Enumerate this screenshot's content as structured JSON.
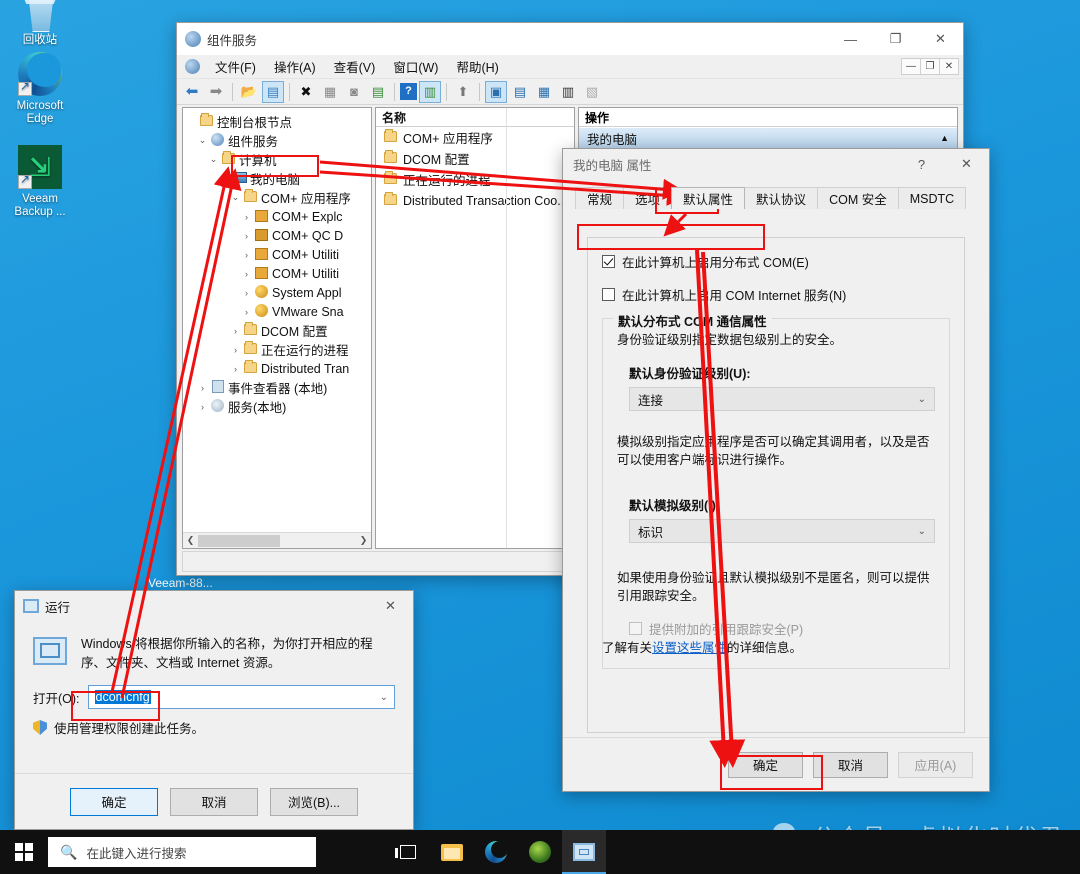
{
  "desktop": {
    "icons": [
      {
        "name": "recycle-bin",
        "label": "回收站"
      },
      {
        "name": "microsoft-edge",
        "label": "Microsoft\nEdge",
        "line1": "Microsoft",
        "line2": "Edge"
      },
      {
        "name": "veeam-backup",
        "label": "Veeam Backup ...",
        "line1": "Veeam",
        "line2": "Backup ..."
      }
    ],
    "veeam_logo_glyph": "⇲",
    "task_label": "Veeam-88..."
  },
  "mmc": {
    "title": "组件服务",
    "menu": [
      {
        "label": "文件(F)"
      },
      {
        "label": "操作(A)"
      },
      {
        "label": "查看(V)"
      },
      {
        "label": "窗口(W)"
      },
      {
        "label": "帮助(H)"
      }
    ],
    "mdi_buttons": [
      "—",
      "❐",
      "✕"
    ],
    "window_buttons": {
      "minimize": "—",
      "maximize": "❐",
      "close": "✕"
    },
    "toolbar": [
      {
        "name": "back-icon",
        "glyph": "⬅",
        "color": "#2e7bc4"
      },
      {
        "name": "forward-icon",
        "glyph": "➡",
        "color": "#777777"
      },
      {
        "name": "up-folder-icon",
        "glyph": "📂",
        "color": "#d9a43a"
      },
      {
        "name": "show-console-tree-icon",
        "glyph": "▤",
        "selected": true
      },
      {
        "name": "delete-icon",
        "glyph": "✖",
        "color": "#111111"
      },
      {
        "name": "properties-icon",
        "glyph": "▦",
        "color": "#8a8a8a"
      },
      {
        "name": "refresh-icon",
        "glyph": "◙",
        "color": "#8a8a8a"
      },
      {
        "name": "export-list-icon",
        "glyph": "▤",
        "color": "#3c8c3c"
      },
      {
        "name": "help-icon",
        "glyph": "?",
        "color": "#ffffff"
      },
      {
        "name": "show-action-pane-icon",
        "glyph": "▥",
        "selected": true
      },
      {
        "name": "new-window-icon",
        "glyph": "⬆",
        "color": "#777777"
      },
      {
        "name": "large-icons-icon",
        "glyph": "▣",
        "selected": true
      },
      {
        "name": "small-icons-icon",
        "glyph": "▤"
      },
      {
        "name": "list-view-icon",
        "glyph": "▦"
      },
      {
        "name": "detail-view-icon",
        "glyph": "▥"
      },
      {
        "name": "filter-icon",
        "glyph": "▧",
        "color": "#9a9a9a"
      }
    ],
    "tree": [
      {
        "depth": 0,
        "twisty": "",
        "icon": "folder",
        "label": "控制台根节点"
      },
      {
        "depth": 1,
        "twisty": "⌄",
        "icon": "services",
        "label": "组件服务"
      },
      {
        "depth": 2,
        "twisty": "⌄",
        "icon": "folder",
        "label": "计算机"
      },
      {
        "depth": 3,
        "twisty": "⌄",
        "icon": "computer",
        "label": "我的电脑",
        "highlighted": true
      },
      {
        "depth": 4,
        "twisty": "⌄",
        "icon": "folder",
        "label": "COM+ 应用程序"
      },
      {
        "depth": 5,
        "twisty": "›",
        "icon": "comapp",
        "label": "COM+ Explc"
      },
      {
        "depth": 5,
        "twisty": "›",
        "icon": "comapp2",
        "label": "COM+ QC D"
      },
      {
        "depth": 5,
        "twisty": "›",
        "icon": "comapp",
        "label": "COM+ Utiliti"
      },
      {
        "depth": 5,
        "twisty": "›",
        "icon": "comapp",
        "label": "COM+ Utiliti"
      },
      {
        "depth": 5,
        "twisty": "›",
        "icon": "sysapp",
        "label": "System Appl"
      },
      {
        "depth": 5,
        "twisty": "›",
        "icon": "sysapp",
        "label": "VMware Sna"
      },
      {
        "depth": 4,
        "twisty": "›",
        "icon": "folder",
        "label": "DCOM 配置"
      },
      {
        "depth": 4,
        "twisty": "›",
        "icon": "folder",
        "label": "正在运行的进程"
      },
      {
        "depth": 4,
        "twisty": "›",
        "icon": "folder",
        "label": "Distributed Tran"
      },
      {
        "depth": 1,
        "twisty": "›",
        "icon": "eventlog",
        "label": "事件查看器 (本地)"
      },
      {
        "depth": 1,
        "twisty": "›",
        "icon": "gear",
        "label": "服务(本地)"
      }
    ],
    "list": {
      "header": "名称",
      "rows": [
        {
          "label": "COM+ 应用程序"
        },
        {
          "label": "DCOM 配置"
        },
        {
          "label": "正在运行的进程"
        },
        {
          "label": "Distributed Transaction Coo..."
        }
      ]
    },
    "action_pane": {
      "header": "操作",
      "item": "我的电脑",
      "collapse_glyph": "▲"
    }
  },
  "props": {
    "title": "我的电脑 属性",
    "help_button": "?",
    "close_button": "✕",
    "tabs": [
      {
        "label": "常规"
      },
      {
        "label": "选项"
      },
      {
        "label": "默认属性",
        "active": true
      },
      {
        "label": "默认协议"
      },
      {
        "label": "COM 安全"
      },
      {
        "label": "MSDTC"
      }
    ],
    "checkbox_dcom": {
      "label": "在此计算机上启用分布式 COM(E)",
      "checked": true
    },
    "checkbox_cis": {
      "label": "在此计算机上启用 COM Internet 服务(N)",
      "checked": false
    },
    "group": {
      "legend": "默认分布式 COM 通信属性",
      "auth_desc": "身份验证级别指定数据包级别上的安全。",
      "auth_label": "默认身份验证级别(U):",
      "auth_value": "连接",
      "imp_desc": "模拟级别指定应用程序是否可以确定其调用者，以及是否可以使用客户端标识进行操作。",
      "imp_label": "默认模拟级别(I):",
      "imp_value": "标识",
      "ref_desc": "如果使用身份验证且默认模拟级别不是匿名，则可以提供引用跟踪安全。",
      "ref_checkbox": {
        "label": "提供附加的引用跟踪安全(P)",
        "checked": false,
        "disabled": true
      }
    },
    "learn_more": {
      "prefix": "了解有关",
      "link": "设置这些属性",
      "suffix": "的详细信息。"
    },
    "buttons": [
      {
        "label": "确定",
        "name": "ok-button",
        "disabled": false
      },
      {
        "label": "取消",
        "name": "cancel-button",
        "disabled": false
      },
      {
        "label": "应用(A)",
        "name": "apply-button",
        "disabled": true
      }
    ],
    "dropdown_glyph": "⌄"
  },
  "run": {
    "title": "运行",
    "close_button": "✕",
    "description": "Windows 将根据你所输入的名称，为你打开相应的程序、文件夹、文档或 Internet 资源。",
    "open_label": "打开(O):",
    "open_value": "dcomcnfg",
    "dropdown_glyph": "⌄",
    "uac_note": "使用管理权限创建此任务。",
    "buttons": [
      {
        "label": "确定",
        "name": "run-ok-button",
        "default": true
      },
      {
        "label": "取消",
        "name": "run-cancel-button",
        "default": false
      },
      {
        "label": "浏览(B)...",
        "name": "run-browse-button",
        "default": false
      }
    ]
  },
  "taskbar": {
    "search_placeholder": "在此键入进行搜索",
    "search_icon": "search-icon",
    "items": [
      {
        "name": "task-view-button"
      },
      {
        "name": "file-explorer-button"
      },
      {
        "name": "edge-taskbar-button"
      },
      {
        "name": "veeam-taskbar-button"
      },
      {
        "name": "component-services-taskbar-button",
        "active": true
      }
    ]
  },
  "watermark": {
    "text": "公众号 · 虚拟化时代君"
  },
  "annotation": {
    "color": "#ee1111"
  }
}
